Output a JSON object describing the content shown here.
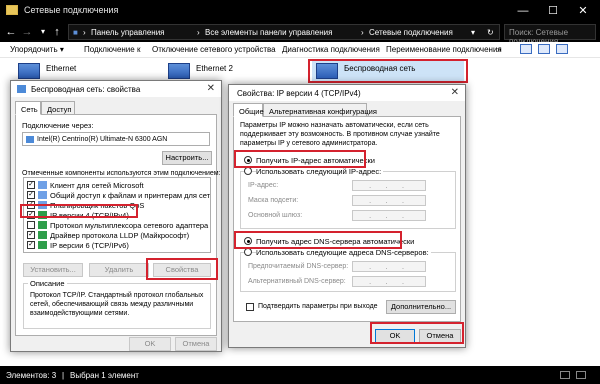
{
  "explorer": {
    "title": "Сетевые подключения",
    "breadcrumb": [
      "Панель управления",
      "Все элементы панели управления",
      "Сетевые подключения"
    ],
    "search_placeholder": "Поиск: Сетевые подключения",
    "commands": [
      "Упорядочить ▾",
      "Подключение к",
      "Отключение сетевого устройства",
      "Диагностика подключения",
      "Переименование подключения",
      "»"
    ],
    "connections": [
      "Ethernet",
      "Ethernet 2",
      "Беспроводная сеть"
    ],
    "status": {
      "items": "Элементов: 3",
      "selected": "Выбран 1 элемент"
    }
  },
  "adapter_dialog": {
    "title": "Беспроводная сеть: свойства",
    "tabs": [
      "Сеть",
      "Доступ"
    ],
    "connect_using_label": "Подключение через:",
    "adapter_name": "Intel(R) Centrino(R) Ultimate-N 6300 AGN",
    "configure_button": "Настроить...",
    "components_label": "Отмеченные компоненты используются этим подключением:",
    "components": [
      {
        "label": "Клиент для сетей Microsoft",
        "checked": true
      },
      {
        "label": "Общий доступ к файлам и принтерам для сетей Mi",
        "checked": true
      },
      {
        "label": "Планировщик пакетов QoS",
        "checked": true
      },
      {
        "label": "IP версии 4 (TCP/IPv4)",
        "checked": true
      },
      {
        "label": "Протокол мультиплексора сетевого адаптера (Ма",
        "checked": false
      },
      {
        "label": "Драйвер протокола LLDP (Майкрософт)",
        "checked": true
      },
      {
        "label": "IP версии 6 (TCP/IPv6)",
        "checked": true
      }
    ],
    "install_button": "Установить...",
    "remove_button": "Удалить",
    "properties_button": "Свойства",
    "description_label": "Описание",
    "description_text": [
      "Протокол TCP/IP. Стандартный протокол глобальных",
      "сетей, обеспечивающий связь между различными",
      "взаимодействующими сетями."
    ],
    "ok_button": "OK",
    "cancel_button": "Отмена"
  },
  "ipv4_dialog": {
    "title": "Свойства: IP версии 4 (TCP/IPv4)",
    "tabs": [
      "Общие",
      "Альтернативная конфигурация"
    ],
    "intro_text": [
      "Параметры IP можно назначать автоматически, если сеть",
      "поддерживает эту возможность. В противном случае узнайте",
      "параметры IP у сетевого администратора."
    ],
    "auto_ip_label": "Получить IP-адрес автоматически",
    "auto_ip_selected": true,
    "manual_ip_label": "Использовать следующий IP-адрес:",
    "ip_address_label": "IP-адрес:",
    "subnet_label": "Маска подсети:",
    "gateway_label": "Основной шлюз:",
    "auto_dns_label": "Получить адрес DNS-сервера автоматически",
    "auto_dns_selected": true,
    "manual_dns_label": "Использовать следующие адреса DNS-серверов:",
    "preferred_dns_label": "Предпочитаемый DNS-сервер:",
    "alternate_dns_label": "Альтернативный DNS-сервер:",
    "validate_label": "Подтвердить параметры при выходе",
    "advanced_button": "Дополнительно...",
    "ok_button": "OK",
    "cancel_button": "Отмена"
  }
}
